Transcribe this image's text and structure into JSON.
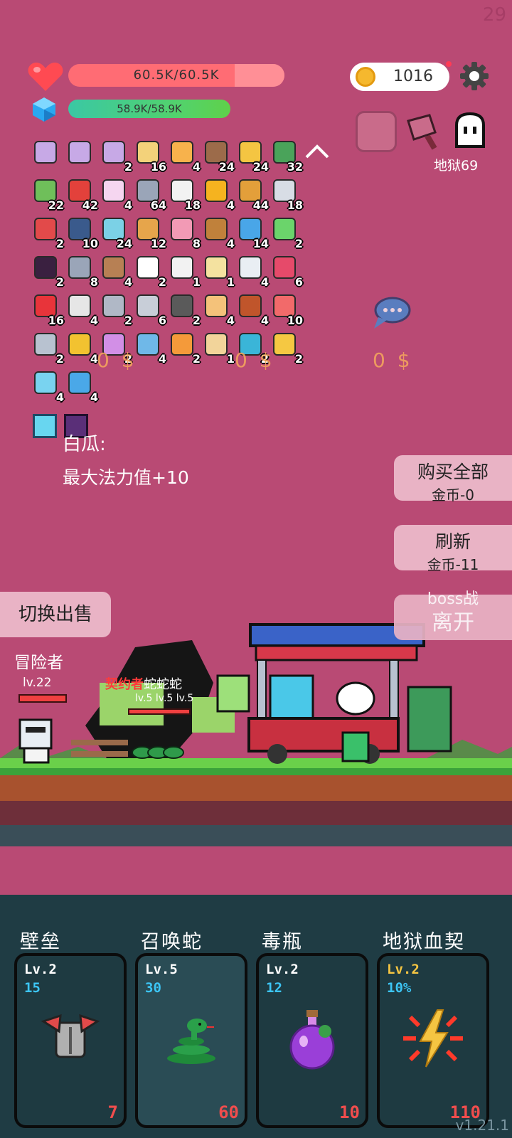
{
  "fps": "29",
  "hud": {
    "hp_text": "60.5K/60.5K",
    "mp_text": "58.9K/58.9K",
    "coins": "1016",
    "hell_level": "地狱69"
  },
  "inventory_rows": [
    [
      {
        "q": ""
      },
      {
        "q": ""
      },
      {
        "q": "2"
      },
      {
        "q": "16"
      },
      {
        "q": "4"
      },
      {
        "q": "24"
      },
      {
        "q": "24"
      },
      {
        "q": "32"
      }
    ],
    [
      {
        "q": "22"
      },
      {
        "q": "42"
      },
      {
        "q": "4"
      },
      {
        "q": "64"
      },
      {
        "q": "18"
      },
      {
        "q": "4"
      },
      {
        "q": "44"
      },
      {
        "q": "18"
      }
    ],
    [
      {
        "q": "2"
      },
      {
        "q": "10"
      },
      {
        "q": "24"
      },
      {
        "q": "12"
      },
      {
        "q": "8"
      },
      {
        "q": "4"
      },
      {
        "q": "14"
      },
      {
        "q": "2"
      }
    ],
    [
      {
        "q": "2"
      },
      {
        "q": "8"
      },
      {
        "q": "4"
      },
      {
        "q": "2"
      },
      {
        "q": "1"
      },
      {
        "q": "1"
      },
      {
        "q": "4"
      },
      {
        "q": "6"
      }
    ],
    [
      {
        "q": "16"
      },
      {
        "q": "4"
      },
      {
        "q": "2"
      },
      {
        "q": "6"
      },
      {
        "q": "2"
      },
      {
        "q": "4"
      },
      {
        "q": "4"
      },
      {
        "q": "10"
      }
    ],
    [
      {
        "q": "2"
      },
      {
        "q": "4"
      },
      {
        "q": "2"
      },
      {
        "q": "4"
      },
      {
        "q": "2"
      },
      {
        "q": "1"
      },
      {
        "q": "2"
      },
      {
        "q": "2"
      }
    ],
    [
      {
        "q": "4"
      },
      {
        "q": "4"
      }
    ]
  ],
  "inventory_colors": [
    "#c7a9e6",
    "#c7a9e6",
    "#c7a9e6",
    "#f3d27a",
    "#f7b24c",
    "#9c6b4a",
    "#f4c542",
    "#4aa35a",
    "#6fbf5a",
    "#e3413b",
    "#f5d6f0",
    "#9aa5b8",
    "#f2f2f2",
    "#f5b31f",
    "#e39f3a",
    "#d8dde5",
    "#e24a4a",
    "#3a5a8c",
    "#7bd1e6",
    "#e6a54b",
    "#f29ab5",
    "#c0813b",
    "#49a6e8",
    "#6bd46b",
    "#3a2040",
    "#9aa5b8",
    "#b78054",
    "#ffffff",
    "#f2f2f2",
    "#f4e2a0",
    "#e9eef3",
    "#e64a6a",
    "#e8343a",
    "#e6e6e6",
    "#b0b8c6",
    "#c8ced8",
    "#5a5a5a",
    "#f4c27a",
    "#c0552b",
    "#f26a6a",
    "#b8c2d0",
    "#f2c230",
    "#d28fe6",
    "#6fb8e8",
    "#f49a3a",
    "#f2d49a",
    "#3ab5d8",
    "#f5c842",
    "#79d3f0",
    "#4aa8e8"
  ],
  "prices": [
    "0 $",
    "0 $",
    "0 $"
  ],
  "item_name": "白瓜:",
  "item_desc": "最大法力值+10",
  "buttons": {
    "buy_all": "购买全部",
    "buy_all_cost": "金币-0",
    "refresh": "刷新",
    "refresh_cost": "金币-11",
    "boss_war": "boss战",
    "leave": "离开",
    "switch_sell": "切换出售"
  },
  "battle": {
    "adventurer_name": "冒险者",
    "adventurer_level": "lv.22",
    "contract_label": "契约者",
    "snake_label": "蛇蛇蛇",
    "snake_levels": "lv.5 lv.5 lv.5"
  },
  "skills": [
    {
      "name": "壁垒",
      "level": "Lv.2",
      "value": "15",
      "cost": "7",
      "icon": "armor-icon",
      "level_color": "#ffffff"
    },
    {
      "name": "召唤蛇",
      "level": "Lv.5",
      "value": "30",
      "cost": "60",
      "icon": "snake-icon",
      "level_color": "#ffffff"
    },
    {
      "name": "毒瓶",
      "level": "Lv.2",
      "value": "12",
      "cost": "10",
      "icon": "poison-bottle-icon",
      "level_color": "#ffffff"
    },
    {
      "name": "地狱血契",
      "level": "Lv.2",
      "value": "10%",
      "cost": "110",
      "icon": "lightning-burst-icon",
      "level_color": "#f5c542"
    }
  ],
  "colors": {
    "background": "#b94a74",
    "hp": "#ff6c74",
    "mp": "#53d26a",
    "skill_value": "#3cc5f5",
    "skill_cost": "#f04d4d",
    "panel": "#1f3c44"
  },
  "version": "v1.21.1"
}
